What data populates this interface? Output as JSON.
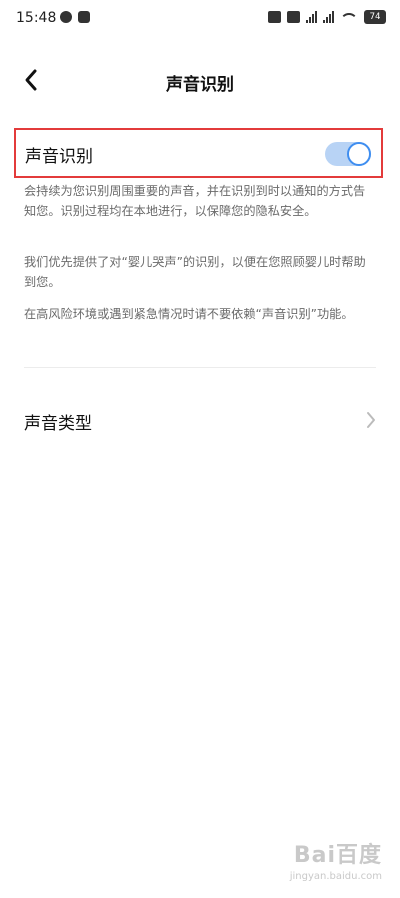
{
  "status_bar": {
    "time": "15:48",
    "battery": "74"
  },
  "nav": {
    "title": "声音识别"
  },
  "toggle": {
    "label": "声音识别",
    "state": "on",
    "accent": "#3f8ef0"
  },
  "description": {
    "p1": "会持续为您识别周围重要的声音，并在识别到时以通知的方式告知您。识别过程均在本地进行，以保障您的隐私安全。",
    "p2": "我们优先提供了对“婴儿哭声”的识别，以便在您照顾婴儿时帮助到您。",
    "p3": "在高风险环境或遇到紧急情况时请不要依赖“声音识别”功能。"
  },
  "list": {
    "sound_types_label": "声音类型"
  },
  "watermark": {
    "logo": "Bai百度",
    "url": "jingyan.baidu.com"
  },
  "colors": {
    "highlight_border": "#e33b3b",
    "toggle_track": "#b8d3f5"
  }
}
